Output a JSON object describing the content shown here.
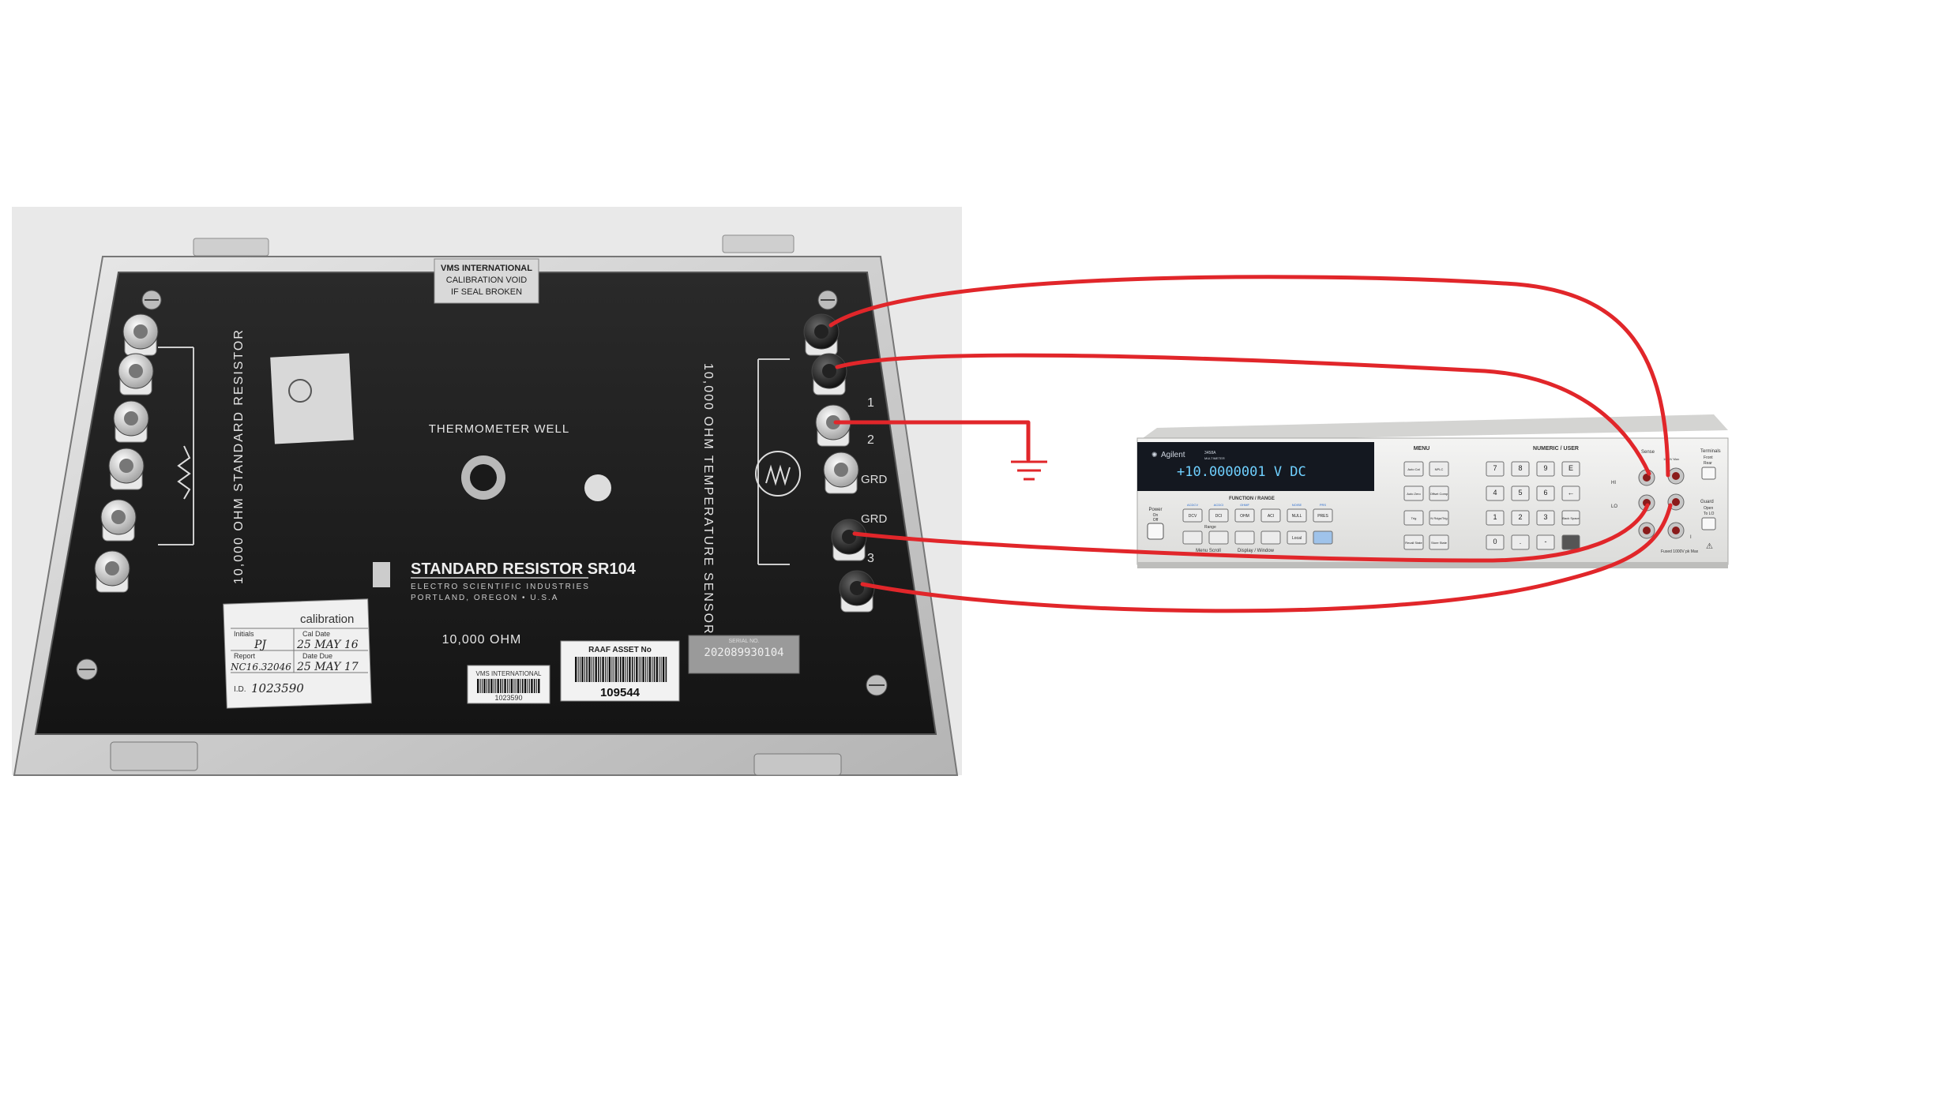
{
  "resistor": {
    "seal_line1": "VMS INTERNATIONAL",
    "seal_line2": "CALIBRATION VOID",
    "seal_line3": "IF SEAL BROKEN",
    "left_vertical_label": "10,000 OHM   STANDARD RESISTOR",
    "right_vertical_label": "10,000 OHM  TEMPERATURE SENSOR",
    "thermometer_label": "THERMOMETER WELL",
    "model_name": "STANDARD RESISTOR    SR104",
    "maker_line1": "ELECTRO SCIENTIFIC INDUSTRIES",
    "maker_line2": "PORTLAND, OREGON • U.S.A",
    "value_label": "10,000 OHM",
    "asset_tag_title": "RAAF ASSET No",
    "asset_tag_number": "109544",
    "vms_tag_title": "VMS INTERNATIONAL",
    "vms_tag_number": "1023590",
    "serial_label": "SERIAL NO.",
    "serial_number": "202089930104",
    "right_terminal_labels": [
      "1",
      "2",
      "GRD",
      "GRD",
      "3"
    ],
    "calibration_label": {
      "brand": "calibration",
      "initials_label": "Initials",
      "initials": "PJ",
      "cal_date_label": "Cal Date",
      "cal_date": "25 MAY 16",
      "report_label": "Report",
      "report": "NC16.32046",
      "date_due_label": "Date Due",
      "date_due": "25 MAY 17",
      "id_label": "I.D.",
      "id": "1023590"
    }
  },
  "multimeter": {
    "brand": "Agilent",
    "model": "3458A",
    "model_sub": "MULTIMETER",
    "display_value": "+10.0000001 V DC",
    "menu_title": "MENU",
    "numeric_title": "NUMERIC / USER",
    "function_title": "FUNCTION / RANGE",
    "power_label": "Power",
    "power_on": "On",
    "power_off": "Off",
    "range_label": "Range",
    "menu_scroll_label": "Menu Scroll",
    "display_window_label": "Display / Window",
    "function_keys": [
      "DCV",
      "DCI",
      "OHM",
      "ACI",
      "NULL",
      "PRES"
    ],
    "function_subs": [
      "ACDCV",
      "ACDCI",
      "OHMF",
      "",
      "NOISE",
      "PRS"
    ],
    "bottom_keys": [
      "",
      "",
      "",
      "",
      "Local",
      ""
    ],
    "menu_keys": [
      "Auto Cal",
      "NPLC",
      "Auto Zero",
      "Offset Comp",
      "Trig",
      "N Rdgs/Trig",
      "Recall State",
      "Store State"
    ],
    "numeric_keys": [
      "7",
      "8",
      "9",
      "E",
      "4",
      "5",
      "6",
      "←",
      "1",
      "2",
      "3",
      "Back Space",
      "0",
      ".",
      "-",
      ""
    ],
    "terminals_label": "Terminals",
    "terminals_front": "Front",
    "terminals_rear": "Rear",
    "guard_label": "Guard",
    "guard_open": "Open",
    "guard_to_lo": "To LO",
    "sense_label": "Sense",
    "hi_label": "HI",
    "lo_label": "LO",
    "i_label": "I",
    "spec_label": "1000V Max",
    "fuse_label": "Fused 1000V pk Max"
  },
  "wiring": {
    "wire_color": "#e1262a",
    "ground_symbol": "ground-icon"
  }
}
